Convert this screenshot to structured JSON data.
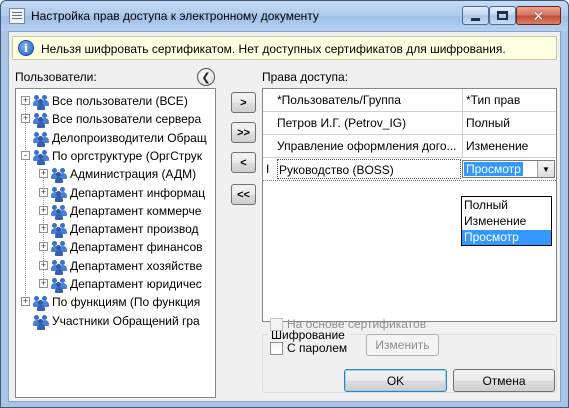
{
  "window": {
    "title": "Настройка прав доступа к электронному документу",
    "minimize_glyph": "–",
    "close_glyph": "✕"
  },
  "info": {
    "icon": "info-icon",
    "icon_glyph": "i",
    "message": "Нельзя шифровать сертификатом. Нет доступных сертификатов для шифрования."
  },
  "users": {
    "label": "Пользователи:",
    "collapse_glyph": "❮",
    "tree": [
      {
        "label": "Все пользователи (ВСЕ)",
        "level": 0,
        "expander": "+"
      },
      {
        "label": "Все пользователи сервера",
        "level": 0,
        "expander": "+"
      },
      {
        "label": "Делопроизводители Обращ",
        "level": 0,
        "expander": ""
      },
      {
        "label": "По оргструктуре (ОргСтрук",
        "level": 0,
        "expander": "-"
      },
      {
        "label": "Администрация (АДМ)",
        "level": 1,
        "expander": "+"
      },
      {
        "label": "Департамент информац",
        "level": 1,
        "expander": "+"
      },
      {
        "label": "Департамент коммерче",
        "level": 1,
        "expander": "+"
      },
      {
        "label": "Департамент производ",
        "level": 1,
        "expander": "+"
      },
      {
        "label": "Департамент финансов",
        "level": 1,
        "expander": "+"
      },
      {
        "label": "Департамент хозяйстве",
        "level": 1,
        "expander": "+"
      },
      {
        "label": "Департамент юридичес",
        "level": 1,
        "expander": "+"
      },
      {
        "label": "По функциям (По функция",
        "level": 0,
        "expander": "+"
      },
      {
        "label": "Участники Обращений гра",
        "level": 0,
        "expander": ""
      }
    ]
  },
  "move_buttons": {
    "add": ">",
    "add_all": ">>",
    "remove": "<",
    "remove_all": "<<"
  },
  "rights": {
    "label": "Права доступа:",
    "columns": [
      "*Пользователь/Группа",
      "*Тип прав"
    ],
    "rows": [
      {
        "marker": "",
        "user": "Петров И.Г. (Petrov_IG)",
        "type": "Полный"
      },
      {
        "marker": "",
        "user": "Управление оформления дого...",
        "type": "Изменение"
      },
      {
        "marker": "I",
        "user": "Руководство (BOSS)",
        "type": "Просмотр"
      }
    ],
    "dropdown_arrow": "▼",
    "dropdown_options": [
      "Полный",
      "Изменение",
      "Просмотр"
    ],
    "dropdown_selected": "Просмотр"
  },
  "encryption": {
    "title": "Шифрование",
    "cert_label": "На основе сертификатов",
    "password_label": "С паролем",
    "change_button": "Изменить"
  },
  "footer": {
    "ok": "OK",
    "cancel": "Отмена"
  }
}
